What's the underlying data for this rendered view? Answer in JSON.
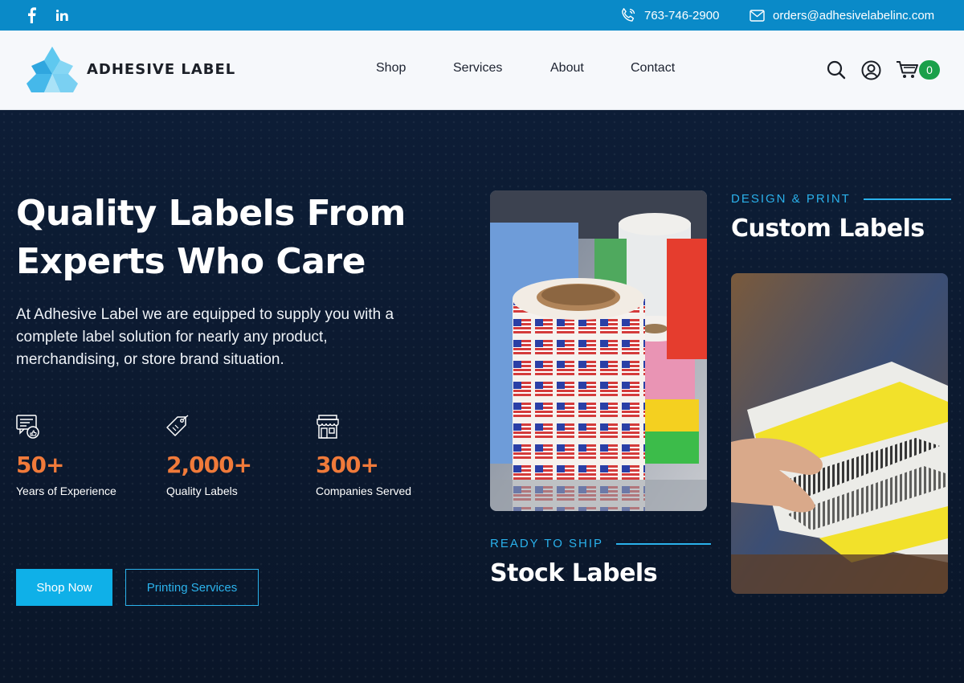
{
  "topbar": {
    "social": [
      {
        "name": "facebook-icon",
        "glyph": "f"
      },
      {
        "name": "linkedin-icon",
        "glyph": "in"
      }
    ],
    "phone": "763-746-2900",
    "email": "orders@adhesivelabelinc.com"
  },
  "header": {
    "logo_text": "ADHESIVE LABEL",
    "nav": [
      "Shop",
      "Services",
      "About",
      "Contact"
    ],
    "cart_count": "0"
  },
  "hero": {
    "title": "Quality Labels From Experts Who Care",
    "description": "At Adhesive Label we are equipped to supply you with a complete label solution for nearly any product, merchandising, or store brand situation.",
    "stats": [
      {
        "icon": "feedback-icon",
        "value": "50+",
        "label": "Years of Experience"
      },
      {
        "icon": "tag-icon",
        "value": "2,000+",
        "label": "Quality Labels"
      },
      {
        "icon": "store-icon",
        "value": "300+",
        "label": "Companies Served"
      }
    ],
    "primary_button": "Shop Now",
    "secondary_button": "Printing Services"
  },
  "cards": {
    "stock": {
      "eyebrow": "READY TO SHIP",
      "title": "Stock Labels"
    },
    "custom": {
      "eyebrow": "DESIGN & PRINT",
      "title": "Custom Labels"
    }
  },
  "colors": {
    "topbar": "#0a8ac8",
    "hero_bg": "#0b1930",
    "accent_blue": "#0fb0e8",
    "stat_orange": "#f07a3a",
    "cart_badge": "#1aa04a"
  }
}
